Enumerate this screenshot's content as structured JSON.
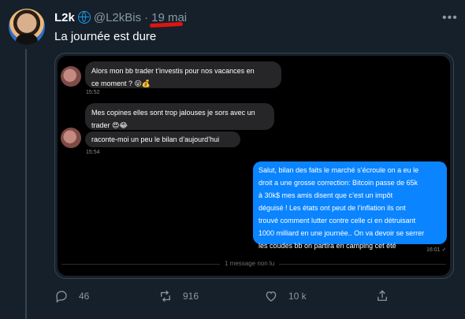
{
  "tweet": {
    "author_name": "L2k",
    "handle": "@L2kBis",
    "separator": "·",
    "date": "19 mai",
    "text": "La journée est dure",
    "more_icon": "more-icon",
    "verified_icon": "globe-icon"
  },
  "chat": {
    "messages": [
      {
        "from": "other",
        "text_line_1": "Alors mon bb trader t’investis pour nos vacances en",
        "text_line_2": "ce moment ? 😛💰",
        "time": "15:52"
      },
      {
        "from": "other",
        "text_line_1": "Mes copines elles sont trop jalouses je sors avec un",
        "text_line_2": "trader 😍😂"
      },
      {
        "from": "other",
        "text": "raconte-moi un peu le bilan d’aujourd’hui",
        "time": "15:54"
      },
      {
        "from": "me",
        "lines": [
          "Salut, bilan des faits le marché s’écroule on a eu le",
          "droit a une grosse correction: Bitcoin passe de 65k",
          "à 30k$ mes amis disent que c’est un impôt",
          "déguisé ! Les états ont peut de l’inflation ils ont",
          "trouvé comment lutter contre celle ci en détruisant",
          "1000 milliard en une journée.. On va devoir se serrer",
          "les coudes bb on partira en camping cet été"
        ],
        "time": "16:01 ✓"
      }
    ],
    "unread_label": "1 message non lu"
  },
  "actions": {
    "reply_count": "46",
    "retweet_count": "916",
    "like_count": "10 k"
  },
  "colors": {
    "background": "#15202b",
    "accent": "#1d9bf0",
    "outgoing_bubble": "#0b84ff",
    "incoming_bubble": "#262628",
    "underline": "#e0140f"
  }
}
